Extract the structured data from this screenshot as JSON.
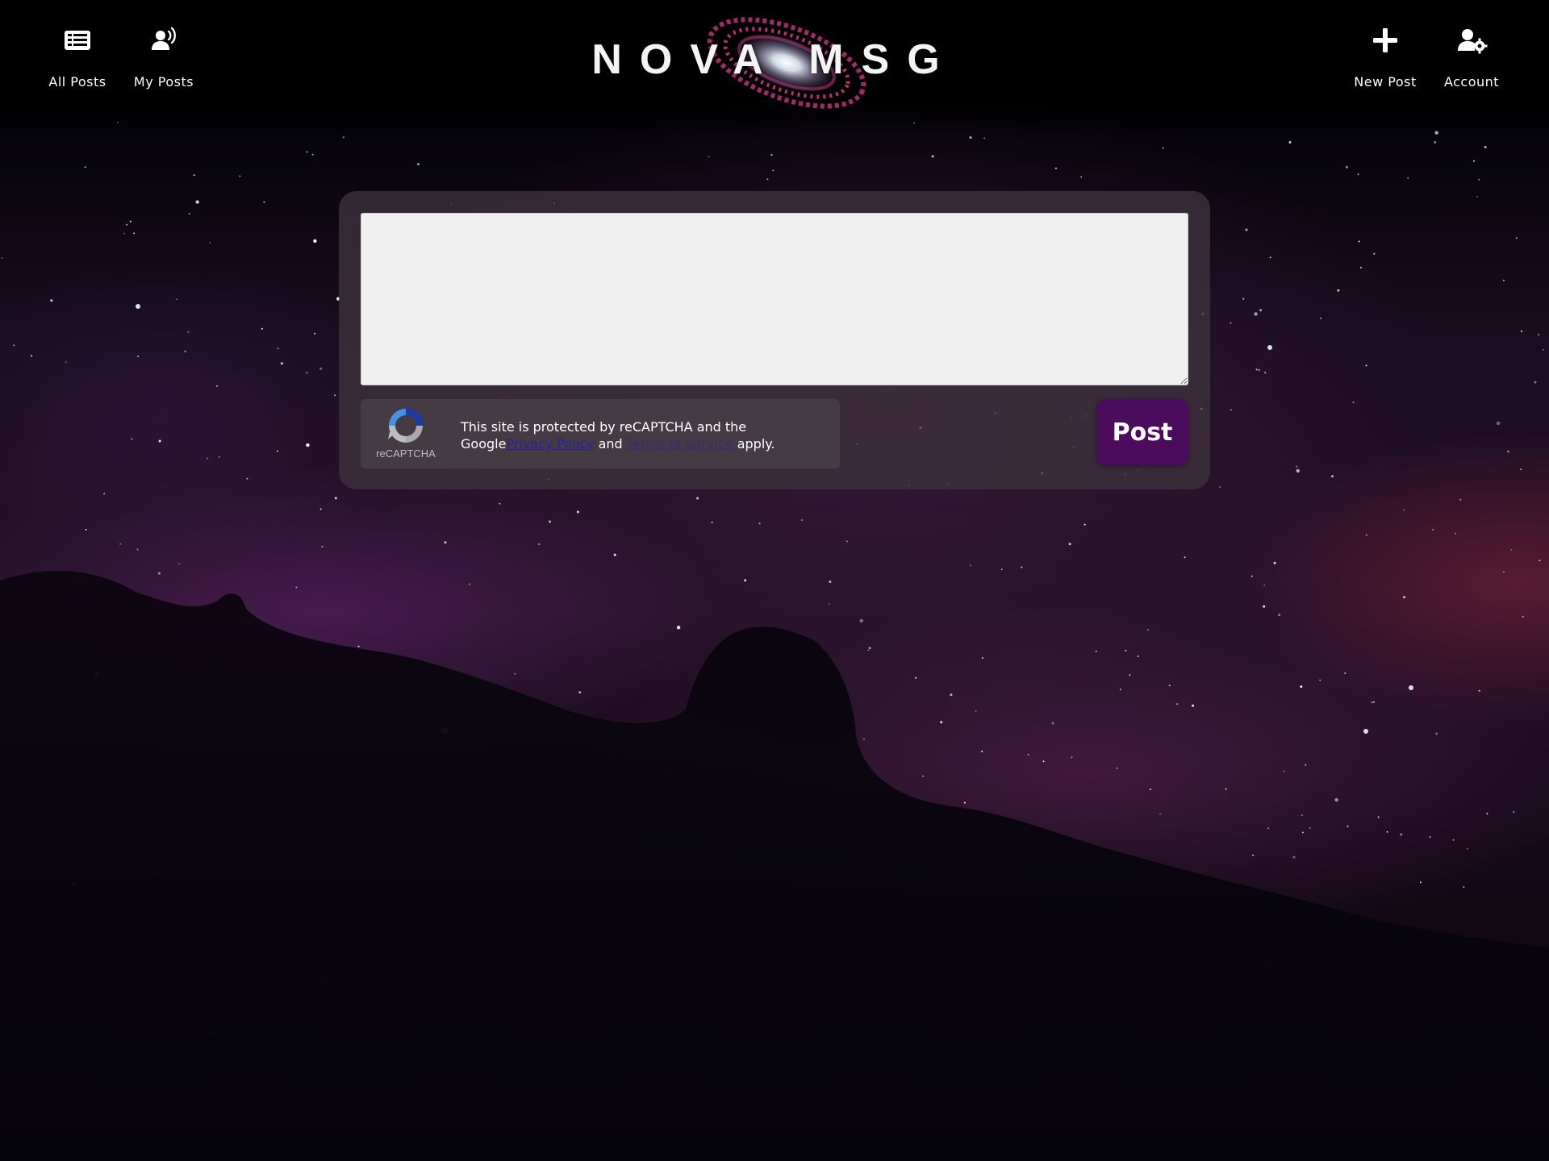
{
  "nav": {
    "left": [
      {
        "label": "All Posts",
        "icon": "list-icon"
      },
      {
        "label": "My Posts",
        "icon": "user-broadcast-icon"
      }
    ],
    "right": [
      {
        "label": "New Post",
        "icon": "plus-icon"
      },
      {
        "label": "Account",
        "icon": "user-gear-icon"
      }
    ]
  },
  "logo": {
    "text": "NOVA MSG",
    "image": "galaxy-logo"
  },
  "composer": {
    "input_value": "",
    "post_label": "Post"
  },
  "recaptcha": {
    "brand": "reCAPTCHA",
    "line1": "This site is protected by reCAPTCHA and the",
    "google": "Google",
    "privacy": "Privacy Policy",
    "and": "and",
    "terms": "Terms of Service",
    "apply": "apply."
  },
  "colors": {
    "post_button": "#4b0c5e",
    "link": "#2a1fa8",
    "card": "#3e323c",
    "input_bg": "#f0f0f0"
  }
}
